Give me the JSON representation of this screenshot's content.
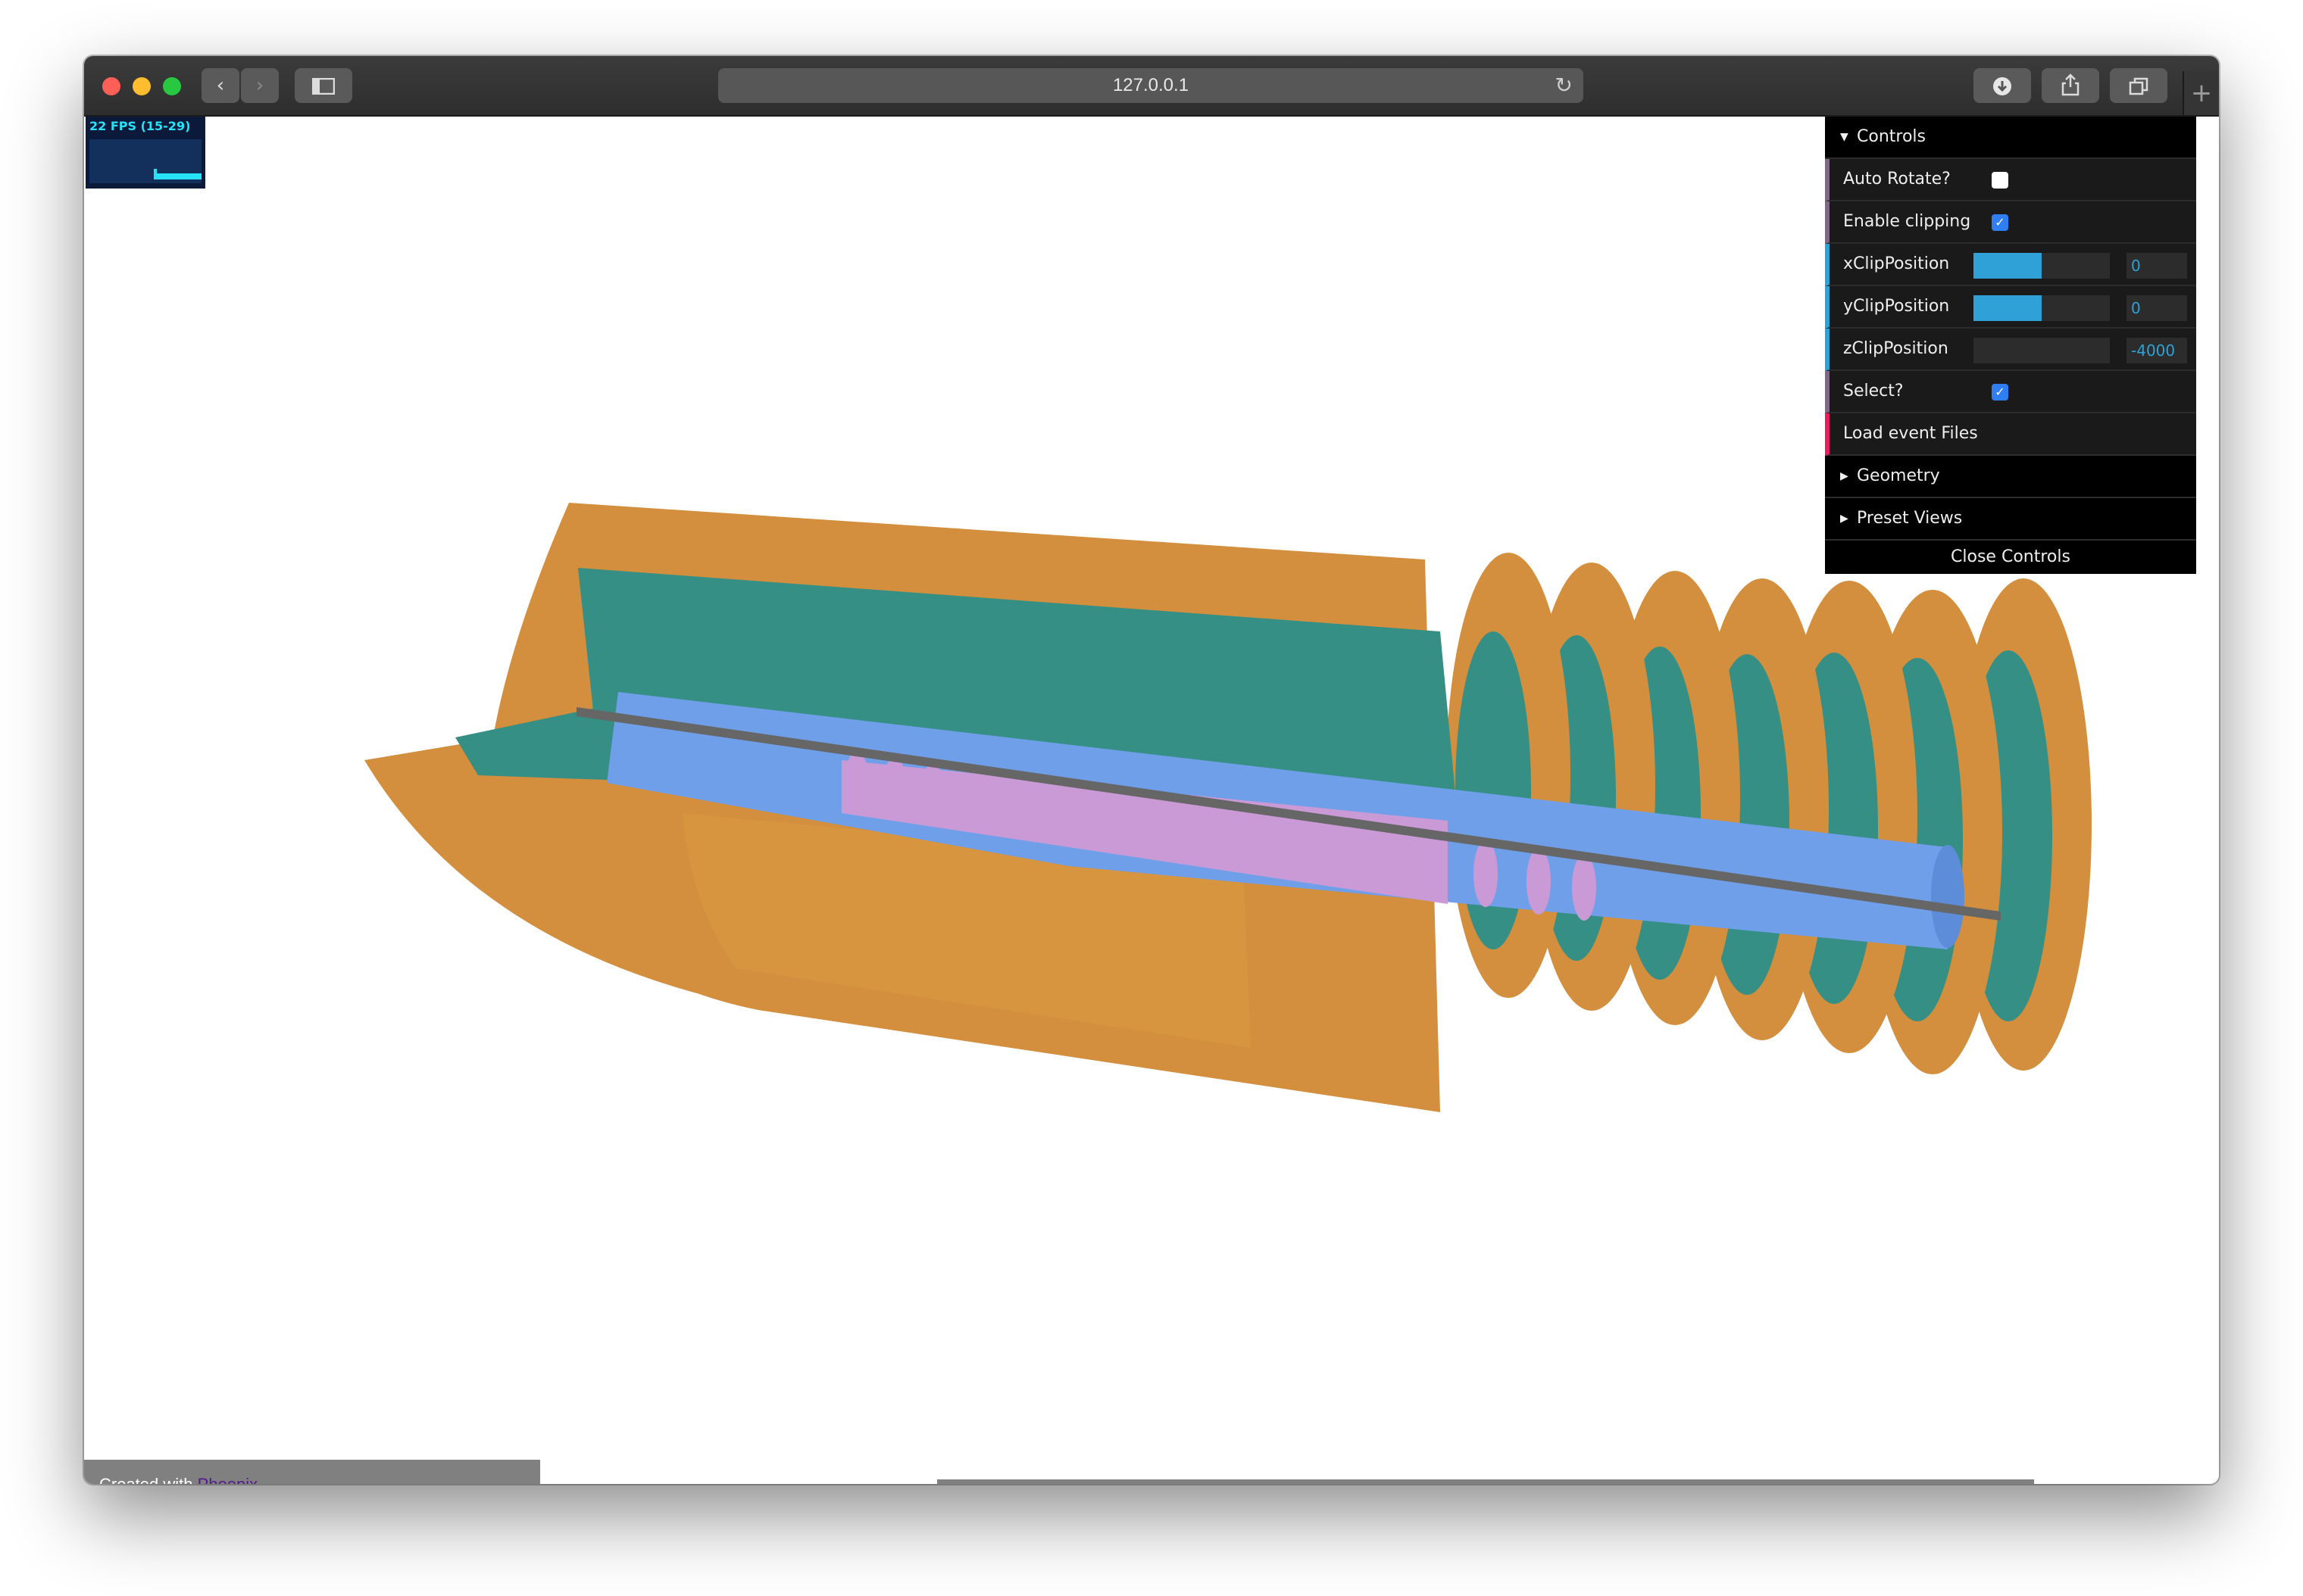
{
  "browser": {
    "address": "127.0.0.1",
    "back_glyph": "‹",
    "forward_glyph": "›",
    "reload_glyph": "↻",
    "new_tab_glyph": "+",
    "traffic_lights": [
      "#fe5f57",
      "#febc2e",
      "#28c840"
    ],
    "icons": [
      "back-icon",
      "forward-icon",
      "sidebar-icon",
      "reload-icon",
      "download-icon",
      "share-icon",
      "tabs-icon",
      "new-tab-icon"
    ]
  },
  "stats": {
    "fps_label": "22 FPS (15-29)"
  },
  "controls": {
    "title": "Controls",
    "auto_rotate_label": "Auto Rotate?",
    "auto_rotate": false,
    "clipping_label": "Enable clipping",
    "clipping": true,
    "x_clip_label": "xClipPosition",
    "x_clip_value": "0",
    "x_clip_level": 0.5,
    "y_clip_label": "yClipPosition",
    "y_clip_value": "0",
    "y_clip_level": 0.5,
    "z_clip_label": "zClipPosition",
    "z_clip_value": "-4000",
    "z_clip_level": 0,
    "select_label": "Select?",
    "select": true,
    "load_label": "Load event Files",
    "geometry_label": "Geometry",
    "preset_views_label": "Preset Views",
    "close_label": "Close Controls",
    "check_glyph": "✓"
  },
  "footer": {
    "created_with": "Created with",
    "phoenix_link": "Phoenix"
  },
  "colors": {
    "orange_detector": "#d38f3d",
    "teal_detector": "#358f85",
    "blue_tracker": "#6f9fe9",
    "pink_pixels": "#c99ad6",
    "beam_pipe": "#666666",
    "accent": "#2fa1d6"
  }
}
